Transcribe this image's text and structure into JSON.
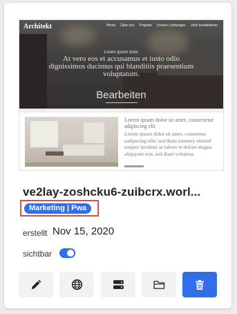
{
  "preview": {
    "brand": "Architekt",
    "nav": [
      "Home",
      "Über uns",
      "Projekte",
      "Unsere Leistungen",
      "Jetzt kontaktieren"
    ],
    "hero_subtitle": "Lorem ipsum dolor",
    "hero_headline": "At vero eos et accusamus et iusto odio dignissimos ducimus qui blanditiis praesentium voluptatum.",
    "edit_label": "Bearbeiten",
    "section_title": "Lorem ipsum dolor sit amet, consectetur adipiscing elit",
    "section_body": "Lorem ipsum dolor sit amet, consetetur sadipscing elitr, sed diam nonumy eirmod tempor invidunt ut labore et dolore magna aliquyam erat, sed diam voluptua."
  },
  "site": {
    "title": "ve2lay-zoshcku6-zuibcrx.worl...",
    "tag": "Marketing | Pwa",
    "created_label": "erstellt",
    "created_date": "Nov 15, 2020",
    "visibility_label": "sichtbar",
    "visible": true
  },
  "actions": [
    {
      "icon": "pencil-icon",
      "action": "edit"
    },
    {
      "icon": "globe-icon",
      "action": "domain"
    },
    {
      "icon": "server-icon",
      "action": "hosting"
    },
    {
      "icon": "folder-icon",
      "action": "files"
    },
    {
      "icon": "trash-icon",
      "action": "delete"
    }
  ],
  "colors": {
    "accent": "#2f6ee8",
    "tag_highlight": "#e04b4b",
    "button_bg": "#f2f2f2"
  }
}
